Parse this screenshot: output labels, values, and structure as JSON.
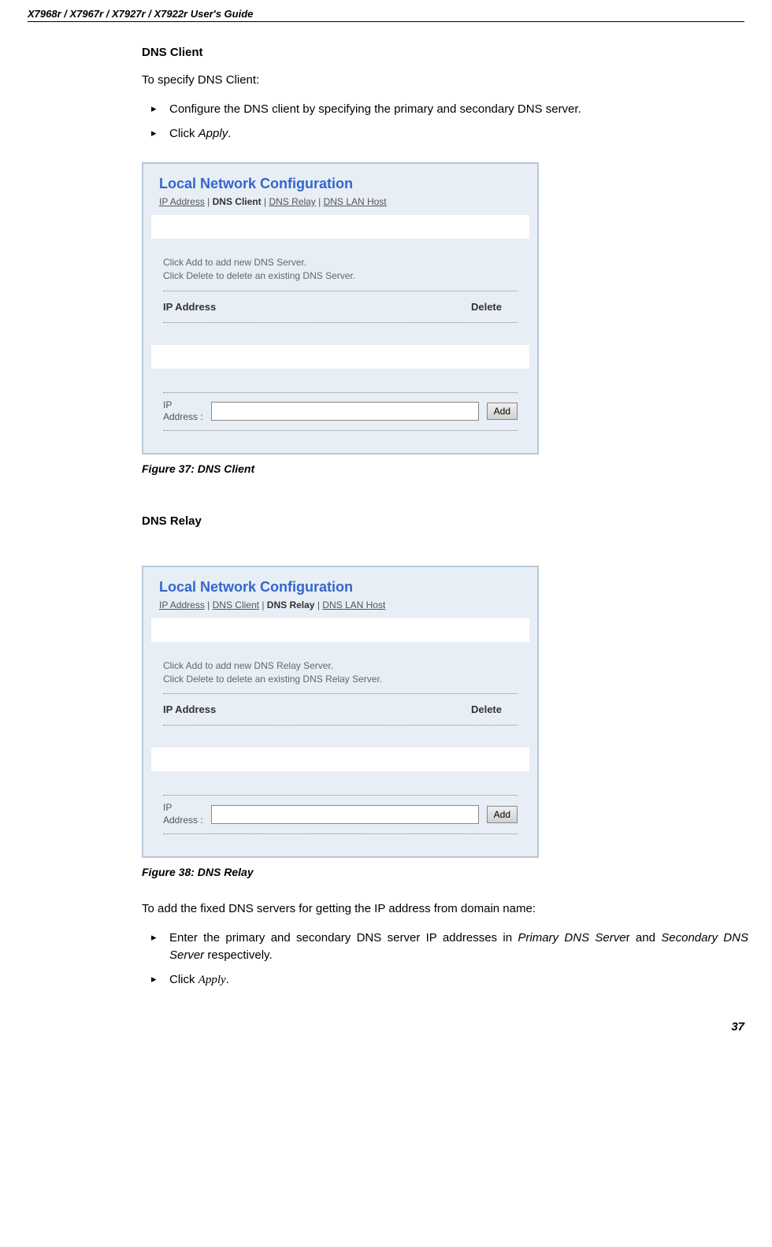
{
  "header": "X7968r / X7967r / X7927r / X7922r User's Guide",
  "pageNumber": "37",
  "section1": {
    "title": "DNS Client",
    "intro": "To specify DNS Client:",
    "bullets": [
      {
        "pre": "Configure the DNS client by specifying the primary and secondary DNS server."
      },
      {
        "pre": "Click ",
        "italic": "Apply",
        "post": "."
      }
    ]
  },
  "screenshot1": {
    "title": "Local Network Configuration",
    "tabs": {
      "ip": "IP Address",
      "client": "DNS Client",
      "relay": "DNS Relay",
      "host": "DNS LAN Host"
    },
    "hint": "Click Add to add new DNS Server.\nClick Delete to delete an existing DNS Server.",
    "col1": "IP Address",
    "col2": "Delete",
    "ipLabel": "IP\nAddress :",
    "addBtn": "Add"
  },
  "figure1": "Figure 37: DNS Client",
  "section2": {
    "title": "DNS Relay"
  },
  "screenshot2": {
    "title": "Local Network Configuration",
    "tabs": {
      "ip": "IP Address",
      "client": "DNS Client",
      "relay": "DNS Relay",
      "host": "DNS LAN Host"
    },
    "hint": "Click Add to add new DNS Relay Server.\nClick Delete to delete an existing DNS Relay Server.",
    "col1": "IP Address",
    "col2": "Delete",
    "ipLabel": "IP\nAddress :",
    "addBtn": "Add"
  },
  "figure2": "Figure 38: DNS Relay",
  "section3": {
    "intro": "To add the fixed DNS servers for getting the IP address from domain name:",
    "bullets": [
      {
        "pre": "Enter the primary and secondary DNS server IP addresses in ",
        "italic1": "Primary DNS Serve",
        "mid": "r and ",
        "italic2": "Secondary DNS Server",
        "post": " respectively."
      },
      {
        "pre": "Click ",
        "serif": "Apply",
        "post": "."
      }
    ]
  }
}
